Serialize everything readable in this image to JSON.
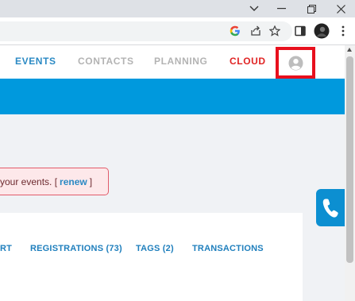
{
  "nav": {
    "items": [
      {
        "label": "EVENTS",
        "color": "#2b8ac4"
      },
      {
        "label": "CONTACTS",
        "color": "#b3b3b3"
      },
      {
        "label": "PLANNING",
        "color": "#b3b3b3"
      },
      {
        "label": "CLOUD",
        "color": "#e02424"
      }
    ],
    "highlight_color": "#e8101d"
  },
  "alert": {
    "text": "your events. [",
    "link": "renew",
    "suffix": "]"
  },
  "tabs": [
    "RT",
    "REGISTRATIONS (73)",
    "TAGS (2)",
    "TRANSACTIONS"
  ],
  "icons": {
    "google": "google-icon",
    "share": "share-icon",
    "star": "star-icon",
    "side_panel": "side-panel-icon",
    "profile": "profile-avatar-icon",
    "menu": "kebab-menu-icon",
    "account": "account-icon",
    "phone": "phone-icon"
  },
  "colors": {
    "banner": "#0099dd",
    "phone_bg": "#0c8fd1"
  }
}
